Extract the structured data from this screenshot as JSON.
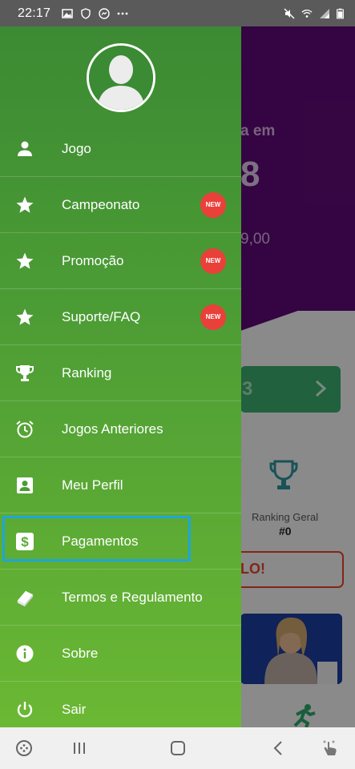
{
  "status_bar": {
    "time": "22:17",
    "left_icons": [
      "gallery-icon",
      "shield-icon",
      "messenger-icon",
      "more-icon"
    ],
    "right_icons": [
      "mute-icon",
      "wifi-icon",
      "signal-icon",
      "battery-icon"
    ]
  },
  "background_app": {
    "hero_line1": "a em",
    "hero_line2": "8",
    "hero_line3": "9,00",
    "green_button_text": "3",
    "ranking_label": "Ranking Geral",
    "ranking_value": "#0",
    "outline_button_text": "LO!"
  },
  "drawer": {
    "menu": [
      {
        "label": "Jogo",
        "icon": "person-icon",
        "badge": null
      },
      {
        "label": "Campeonato",
        "icon": "star-icon",
        "badge": "NEW"
      },
      {
        "label": "Promoção",
        "icon": "star-icon",
        "badge": "NEW"
      },
      {
        "label": "Suporte/FAQ",
        "icon": "star-icon",
        "badge": "NEW"
      },
      {
        "label": "Ranking",
        "icon": "trophy-icon",
        "badge": null
      },
      {
        "label": "Jogos Anteriores",
        "icon": "alarm-icon",
        "badge": null
      },
      {
        "label": "Meu Perfil",
        "icon": "profile-card-icon",
        "badge": null
      },
      {
        "label": "Pagamentos",
        "icon": "dollar-icon",
        "badge": null,
        "highlighted": true
      },
      {
        "label": "Termos e Regulamento",
        "icon": "book-icon",
        "badge": null
      },
      {
        "label": "Sobre",
        "icon": "info-icon",
        "badge": null
      },
      {
        "label": "Sair",
        "icon": "power-icon",
        "badge": null
      }
    ],
    "highlight_color": "#1ea6d8",
    "badge_color": "#e9403a"
  },
  "nav_bar": {
    "buttons": [
      "game-launcher-icon",
      "recents-icon",
      "home-icon",
      "back-icon",
      "assistant-icon"
    ]
  }
}
